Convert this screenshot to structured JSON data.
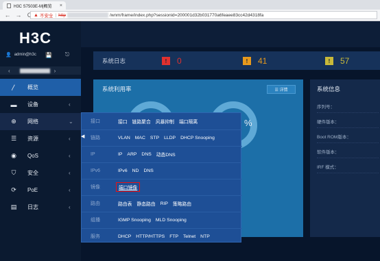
{
  "browser": {
    "tab_title": "H3C S7503E-M|概览",
    "tab_close": "×",
    "back": "←",
    "forward": "→",
    "reload": "C",
    "insecure_label": "不安全",
    "sep": "|",
    "protocol": "http",
    "url_rest": "/wnm/frame/index.php?sessionid=200001d32b031770a6feaee83cc42d4318fa"
  },
  "sidebar": {
    "logo": "H3C",
    "user": "admin@h3c",
    "pager_left": "‹",
    "pager_right": "›",
    "items": [
      {
        "label": "概览",
        "icon": "〳"
      },
      {
        "label": "设备",
        "icon": "▬",
        "chevron": "‹"
      },
      {
        "label": "网络",
        "icon": "⊕",
        "chevron": "⌄"
      },
      {
        "label": "资源",
        "icon": "☰",
        "chevron": "‹"
      },
      {
        "label": "QoS",
        "icon": "◉",
        "chevron": "‹"
      },
      {
        "label": "安全",
        "icon": "⛉",
        "chevron": "‹"
      },
      {
        "label": "PoE",
        "icon": "⟳",
        "chevron": "‹"
      },
      {
        "label": "日志",
        "icon": "▤",
        "chevron": "‹"
      }
    ]
  },
  "log": {
    "title": "系统日志",
    "alerts": [
      {
        "count": "0",
        "color": "#e0312f",
        "label": "!"
      },
      {
        "count": "41",
        "color": "#e79a1d",
        "label": "!"
      },
      {
        "count": "57",
        "color": "#c8b93a",
        "label": "!"
      }
    ]
  },
  "usage_panel": {
    "title": "系统利用率",
    "button": "☰ 详情",
    "percent": "%"
  },
  "info_panel": {
    "title": "系统信息",
    "lines": [
      "序列号：",
      "硬件版本：",
      "Boot ROM版本：",
      "软件版本：",
      "IRF 模式："
    ]
  },
  "network_menu": [
    {
      "category": "接口",
      "items": [
        "接口",
        "链路聚合",
        "风暴抑制",
        "端口隔离"
      ]
    },
    {
      "category": "链路",
      "items": [
        "VLAN",
        "MAC",
        "STP",
        "LLDP",
        "DHCP Snooping"
      ]
    },
    {
      "category": "IP",
      "items": [
        "IP",
        "ARP",
        "DNS",
        "动态DNS"
      ]
    },
    {
      "category": "IPv6",
      "items": [
        "IPv6",
        "ND",
        "DNS"
      ]
    },
    {
      "category": "镜像",
      "items": [
        "端口镜像"
      ]
    },
    {
      "category": "路由",
      "items": [
        "路由表",
        "静态路由",
        "RIP",
        "策略路由"
      ]
    },
    {
      "category": "组播",
      "items": [
        "IGMP Snooping",
        "MLD Snooping"
      ]
    },
    {
      "category": "服务",
      "items": [
        "DHCP",
        "HTTP/HTTPS",
        "FTP",
        "Telnet",
        "NTP"
      ]
    }
  ]
}
